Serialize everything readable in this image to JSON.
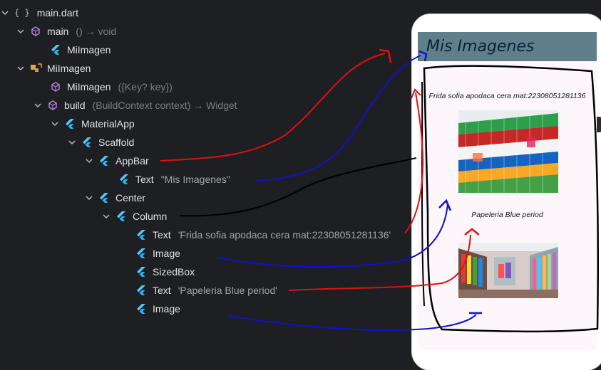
{
  "tree": {
    "rows": [
      {
        "label": "main.dart",
        "sig": "",
        "str": ""
      },
      {
        "label": "main",
        "sig": "() → void",
        "str": ""
      },
      {
        "label": "MiImagen",
        "sig": "",
        "str": ""
      },
      {
        "label": "MiImagen",
        "sig": "",
        "str": ""
      },
      {
        "label": "MiImagen",
        "sig": "({Key? key})",
        "str": ""
      },
      {
        "label": "build",
        "sig": "(BuildContext context) → Widget",
        "str": ""
      },
      {
        "label": "MaterialApp",
        "sig": "",
        "str": ""
      },
      {
        "label": "Scaffold",
        "sig": "",
        "str": ""
      },
      {
        "label": "AppBar",
        "sig": "",
        "str": ""
      },
      {
        "label": "Text",
        "sig": "",
        "str": "\"Mis Imagenes\""
      },
      {
        "label": "Center",
        "sig": "",
        "str": ""
      },
      {
        "label": "Column",
        "sig": "",
        "str": ""
      },
      {
        "label": "Text",
        "sig": "",
        "str": "'Frida sofia apodaca cera mat:22308051281136'"
      },
      {
        "label": "Image",
        "sig": "",
        "str": ""
      },
      {
        "label": "SizedBox",
        "sig": "",
        "str": ""
      },
      {
        "label": "Text",
        "sig": "",
        "str": "'Papeleria Blue period'"
      },
      {
        "label": "Image",
        "sig": "",
        "str": ""
      }
    ]
  },
  "phone": {
    "appbar_title": "Mis Imagenes",
    "caption1": "Frida sofia apodaca cera mat:22308051281136",
    "caption2": "Papeleria Blue period"
  },
  "colors": {
    "background": "#1e1f22",
    "flutter_icon": "#54c5f8",
    "method_icon": "#b47fe0",
    "class_icon": "#e8a33d",
    "appbar": "#5f7f8a",
    "annotation_red": "#e01010",
    "annotation_blue": "#1010d0",
    "annotation_black": "#000000"
  },
  "icons": [
    "braces-icon",
    "method-icon",
    "flutter-icon",
    "class-icon",
    "chevron-down-icon"
  ]
}
